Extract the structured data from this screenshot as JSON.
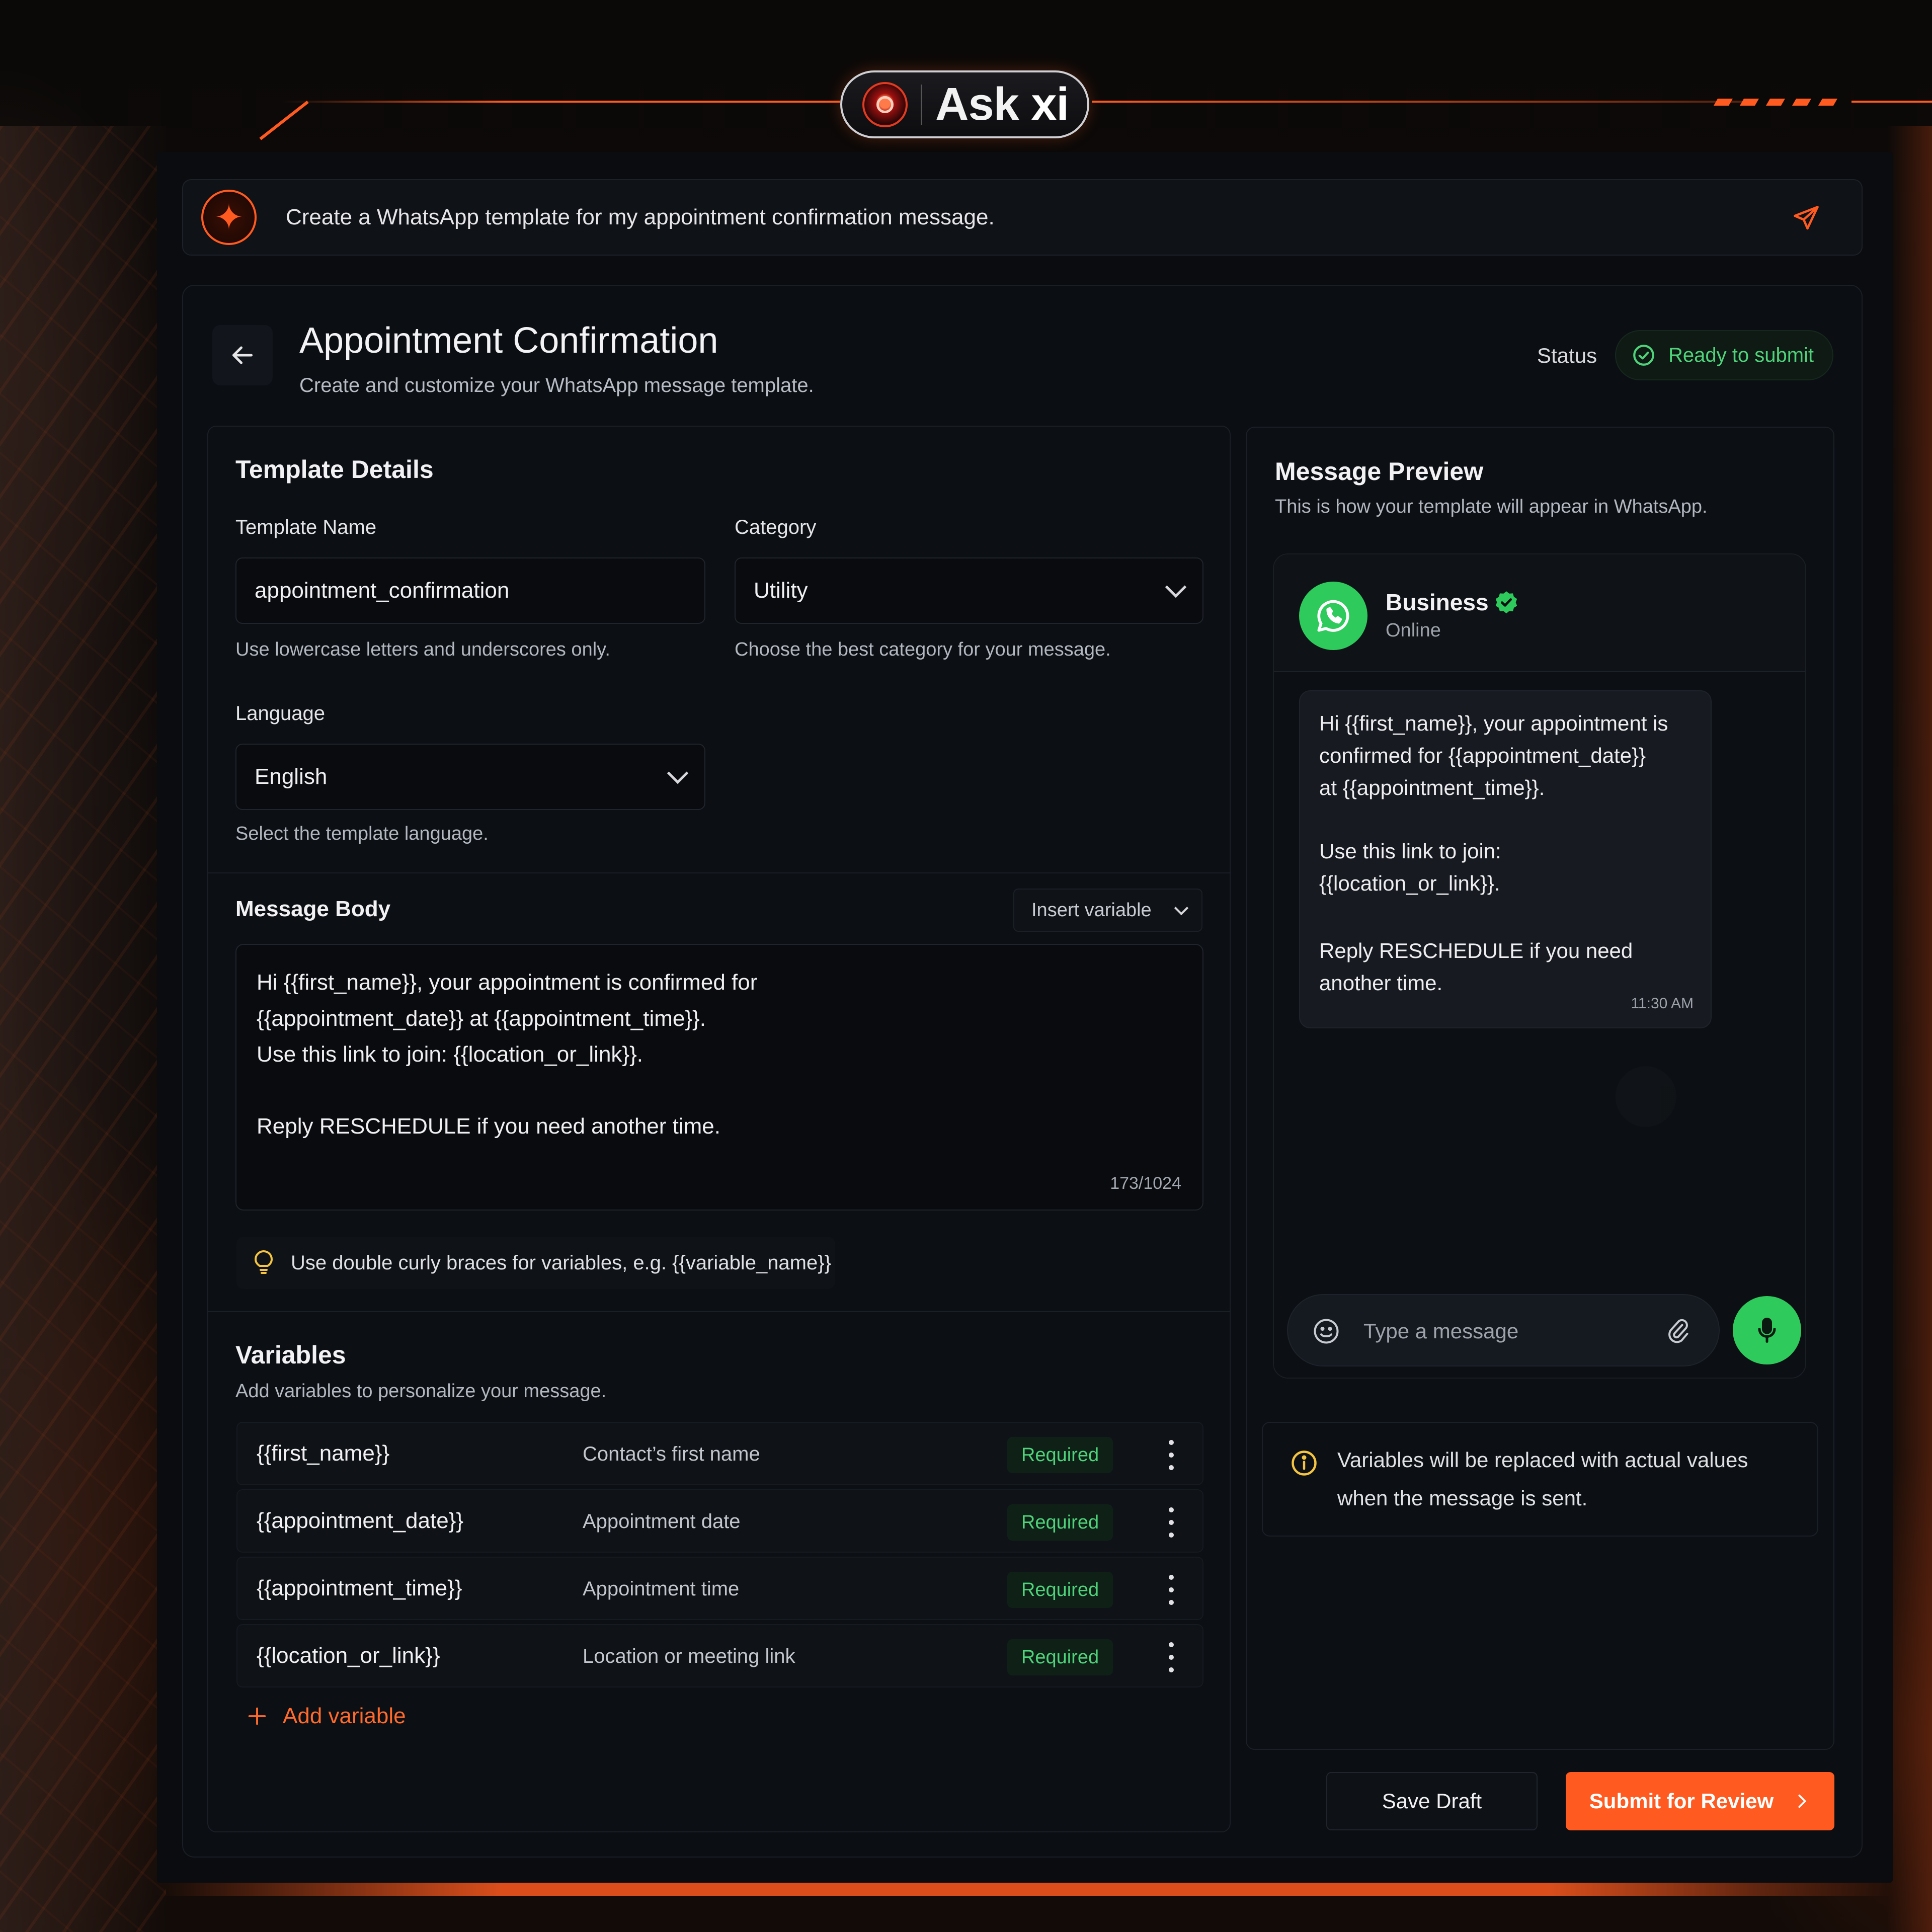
{
  "brand": {
    "name": "Ask",
    "name_suffix": "xi"
  },
  "prompt": {
    "text": "Create a WhatsApp template for my appointment confirmation message."
  },
  "header": {
    "title": "Appointment Confirmation",
    "subtitle": "Create and customize your WhatsApp message template.",
    "status_label": "Status",
    "status_value": "Ready to submit"
  },
  "template_details": {
    "heading": "Template Details",
    "name_label": "Template Name",
    "name_value": "appointment_confirmation",
    "name_help": "Use lowercase letters and underscores only.",
    "category_label": "Category",
    "category_value": "Utility",
    "category_help": "Choose the best category for your message.",
    "language_label": "Language",
    "language_value": "English",
    "language_help": "Select the template language."
  },
  "message_body": {
    "heading": "Message Body",
    "insert_variable": "Insert variable",
    "lines": [
      "Hi {{first_name}}, your appointment is confirmed for",
      "{{appointment_date}} at {{appointment_time}}.",
      "Use this link to join: {{location_or_link}}.",
      "Reply RESCHEDULE if you need another time."
    ],
    "counter": "173/1024",
    "tip": "Use double curly braces for variables, e.g. {{variable_name}}"
  },
  "variables": {
    "heading": "Variables",
    "subtitle": "Add variables to personalize your message.",
    "rows": [
      {
        "name": "{{first_name}}",
        "desc": "Contact’s first name",
        "badge": "Required"
      },
      {
        "name": "{{appointment_date}}",
        "desc": "Appointment date",
        "badge": "Required"
      },
      {
        "name": "{{appointment_time}}",
        "desc": "Appointment time",
        "badge": "Required"
      },
      {
        "name": "{{location_or_link}}",
        "desc": "Location or meeting link",
        "badge": "Required"
      }
    ],
    "add_label": "Add variable"
  },
  "preview": {
    "heading": "Message Preview",
    "subtitle": "This is how your template will appear in WhatsApp.",
    "contact_name": "Business",
    "contact_status": "Online",
    "bubble_lines": [
      "Hi {{first_name}}, your appointment is",
      "confirmed for {{appointment_date}}",
      "at {{appointment_time}}.",
      "Use this link to join:",
      "{{location_or_link}}.",
      "Reply RESCHEDULE if you need",
      "another time."
    ],
    "bubble_time": "11:30 AM",
    "compose_placeholder": "Type a message",
    "info_lines": [
      "Variables will be replaced with actual values",
      "when the message is sent."
    ]
  },
  "actions": {
    "save_draft": "Save Draft",
    "submit": "Submit for Review"
  },
  "colors": {
    "accent": "#ff5a1f",
    "success": "#4fd37a",
    "whatsapp": "#2ecb5c",
    "background": "#0a0c10"
  }
}
